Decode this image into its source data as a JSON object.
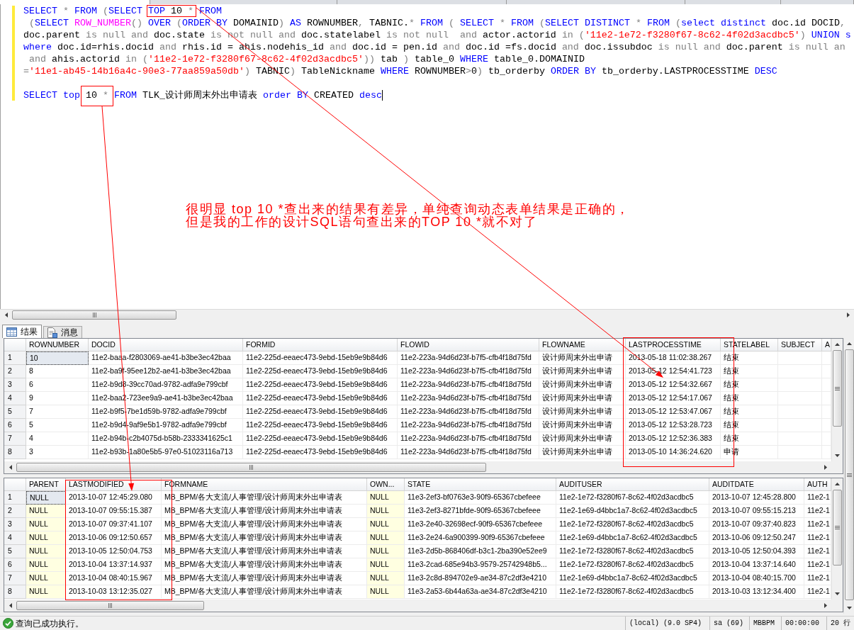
{
  "document_tabs": [
    {
      "selected": true
    },
    {
      "selected": false
    },
    {
      "selected": false
    },
    {
      "selected": false
    },
    {
      "selected": false
    },
    {
      "selected": false
    }
  ],
  "editor": {
    "statements": [
      {
        "lines": [
          {
            "cursor": false,
            "segments": [
              {
                "highlighted": false,
                "tokens": [
                  {
                    "kind": "keyword",
                    "text": "SELECT"
                  },
                  {
                    "kind": "operator",
                    "text": " * "
                  },
                  {
                    "kind": "keyword",
                    "text": "FROM"
                  },
                  {
                    "kind": "operator",
                    "text": " ("
                  },
                  {
                    "kind": "keyword",
                    "text": "SELECT "
                  }
                ]
              },
              {
                "highlighted": true,
                "tokens": [
                  {
                    "kind": "keyword",
                    "text": "TOP"
                  },
                  {
                    "kind": "plain",
                    "text": " 10 "
                  },
                  {
                    "kind": "operator",
                    "text": "*"
                  }
                ]
              },
              {
                "highlighted": false,
                "tokens": [
                  {
                    "kind": "keyword",
                    "text": " FROM"
                  }
                ]
              }
            ]
          },
          {
            "cursor": false,
            "segments": [
              {
                "highlighted": false,
                "tokens": [
                  {
                    "kind": "operator",
                    "text": " ("
                  },
                  {
                    "kind": "keyword",
                    "text": "SELECT "
                  },
                  {
                    "kind": "function",
                    "text": "ROW_NUMBER"
                  },
                  {
                    "kind": "operator",
                    "text": "() "
                  },
                  {
                    "kind": "keyword",
                    "text": "OVER"
                  },
                  {
                    "kind": "operator",
                    "text": " ("
                  },
                  {
                    "kind": "keyword",
                    "text": "ORDER BY"
                  },
                  {
                    "kind": "plain",
                    "text": " DOMAINID"
                  },
                  {
                    "kind": "operator",
                    "text": ") "
                  },
                  {
                    "kind": "keyword",
                    "text": "AS"
                  },
                  {
                    "kind": "plain",
                    "text": " ROWNUMBER"
                  },
                  {
                    "kind": "operator",
                    "text": ","
                  },
                  {
                    "kind": "plain",
                    "text": " TABNIC."
                  },
                  {
                    "kind": "operator",
                    "text": "* "
                  },
                  {
                    "kind": "keyword",
                    "text": "FROM"
                  },
                  {
                    "kind": "operator",
                    "text": " ( "
                  },
                  {
                    "kind": "keyword",
                    "text": "SELECT"
                  },
                  {
                    "kind": "operator",
                    "text": " * "
                  },
                  {
                    "kind": "keyword",
                    "text": "FROM"
                  },
                  {
                    "kind": "operator",
                    "text": " ("
                  },
                  {
                    "kind": "keyword",
                    "text": "SELECT DISTINCT"
                  },
                  {
                    "kind": "operator",
                    "text": " * "
                  },
                  {
                    "kind": "keyword",
                    "text": "FROM"
                  },
                  {
                    "kind": "operator",
                    "text": " ("
                  },
                  {
                    "kind": "keyword",
                    "text": "select distinct"
                  },
                  {
                    "kind": "plain",
                    "text": " doc.id DOCID"
                  },
                  {
                    "kind": "operator",
                    "text": ","
                  }
                ]
              }
            ]
          },
          {
            "cursor": false,
            "segments": [
              {
                "highlighted": false,
                "tokens": [
                  {
                    "kind": "plain",
                    "text": "doc.parent"
                  },
                  {
                    "kind": "operator",
                    "text": " is null and "
                  },
                  {
                    "kind": "plain",
                    "text": "doc.state"
                  },
                  {
                    "kind": "operator",
                    "text": " is not null and "
                  },
                  {
                    "kind": "plain",
                    "text": "doc.statelabel"
                  },
                  {
                    "kind": "operator",
                    "text": " is not null  and "
                  },
                  {
                    "kind": "plain",
                    "text": "actor.actorid "
                  },
                  {
                    "kind": "operator",
                    "text": "in ("
                  },
                  {
                    "kind": "string",
                    "text": "'11e2-1e72-f3280f67-8c62-4f02d3acdbc5'"
                  },
                  {
                    "kind": "operator",
                    "text": ") "
                  },
                  {
                    "kind": "keyword",
                    "text": "UNION s"
                  }
                ]
              }
            ]
          },
          {
            "cursor": false,
            "segments": [
              {
                "highlighted": false,
                "tokens": [
                  {
                    "kind": "keyword",
                    "text": "where"
                  },
                  {
                    "kind": "plain",
                    "text": " doc.id=rhis.docid "
                  },
                  {
                    "kind": "operator",
                    "text": "and"
                  },
                  {
                    "kind": "plain",
                    "text": " rhis.id = ahis.nodehis_id "
                  },
                  {
                    "kind": "operator",
                    "text": "and"
                  },
                  {
                    "kind": "plain",
                    "text": " doc.id = pen.id "
                  },
                  {
                    "kind": "operator",
                    "text": "and"
                  },
                  {
                    "kind": "plain",
                    "text": " doc.id =fs.docid "
                  },
                  {
                    "kind": "operator",
                    "text": "and"
                  },
                  {
                    "kind": "plain",
                    "text": " doc.issubdoc "
                  },
                  {
                    "kind": "operator",
                    "text": "is null and"
                  },
                  {
                    "kind": "plain",
                    "text": " doc.parent "
                  },
                  {
                    "kind": "operator",
                    "text": "is null an"
                  }
                ]
              }
            ]
          },
          {
            "cursor": false,
            "segments": [
              {
                "highlighted": false,
                "tokens": [
                  {
                    "kind": "operator",
                    "text": " and"
                  },
                  {
                    "kind": "plain",
                    "text": " ahis.actorid "
                  },
                  {
                    "kind": "operator",
                    "text": "in ("
                  },
                  {
                    "kind": "string",
                    "text": "'11e2-1e72-f3280f67-8c62-4f02d3acdbc5'"
                  },
                  {
                    "kind": "operator",
                    "text": "))"
                  },
                  {
                    "kind": "plain",
                    "text": " tab "
                  },
                  {
                    "kind": "operator",
                    "text": ")"
                  },
                  {
                    "kind": "plain",
                    "text": " table_0 "
                  },
                  {
                    "kind": "keyword",
                    "text": "WHERE"
                  },
                  {
                    "kind": "plain",
                    "text": " table_0.DOMAINID"
                  }
                ]
              }
            ]
          },
          {
            "cursor": false,
            "segments": [
              {
                "highlighted": false,
                "tokens": [
                  {
                    "kind": "operator",
                    "text": "="
                  },
                  {
                    "kind": "string",
                    "text": "'11e1-ab45-14b16a4c-90e3-77aa859a50db'"
                  },
                  {
                    "kind": "operator",
                    "text": ")"
                  },
                  {
                    "kind": "plain",
                    "text": " TABNIC"
                  },
                  {
                    "kind": "operator",
                    "text": ")"
                  },
                  {
                    "kind": "plain",
                    "text": " TableNickname "
                  },
                  {
                    "kind": "keyword",
                    "text": "WHERE"
                  },
                  {
                    "kind": "plain",
                    "text": " ROWNUMBER"
                  },
                  {
                    "kind": "operator",
                    "text": ">"
                  },
                  {
                    "kind": "plain",
                    "text": "0"
                  },
                  {
                    "kind": "operator",
                    "text": ")"
                  },
                  {
                    "kind": "plain",
                    "text": " tb_orderby "
                  },
                  {
                    "kind": "keyword",
                    "text": "ORDER BY"
                  },
                  {
                    "kind": "plain",
                    "text": " tb_orderby.LASTPROCESSTIME "
                  },
                  {
                    "kind": "keyword",
                    "text": "DESC"
                  }
                ]
              }
            ]
          }
        ]
      },
      {
        "lines": [
          {
            "cursor": true,
            "segments": [
              {
                "highlighted": false,
                "tokens": [
                  {
                    "kind": "keyword",
                    "text": "SELECT top "
                  }
                ]
              },
              {
                "highlighted": true,
                "tokens": [
                  {
                    "kind": "plain",
                    "text": "10 "
                  },
                  {
                    "kind": "operator",
                    "text": "*"
                  }
                ]
              },
              {
                "highlighted": false,
                "tokens": [
                  {
                    "kind": "keyword",
                    "text": " FROM"
                  },
                  {
                    "kind": "plain",
                    "text": " TLK_设计师周末外出申请表 "
                  },
                  {
                    "kind": "keyword",
                    "text": "order BY"
                  },
                  {
                    "kind": "plain",
                    "text": " CREATED "
                  },
                  {
                    "kind": "keyword",
                    "text": "desc"
                  }
                ]
              }
            ]
          }
        ]
      }
    ]
  },
  "annotation": {
    "lines": [
      "很明显 top 10 *查出来的结果有差异，单纯查询动态表单结果是正确的，",
      "但是我的工作的设计SQL语句查出来的TOP 10 *就不对了"
    ]
  },
  "result_tabs": [
    {
      "kind": "results",
      "label": "结果",
      "selected": true
    },
    {
      "kind": "messages",
      "label": "消息",
      "selected": false
    }
  ],
  "grids": [
    {
      "columns": [
        {
          "label": "ROWNUMBER",
          "kind": "text"
        },
        {
          "label": "DOCID",
          "kind": "text"
        },
        {
          "label": "FORMID",
          "kind": "text"
        },
        {
          "label": "FLOWID",
          "kind": "text"
        },
        {
          "label": "FLOWNAME",
          "kind": "text"
        },
        {
          "label": "LASTPROCESSTIME",
          "kind": "text"
        },
        {
          "label": "STATELABEL",
          "kind": "text"
        },
        {
          "label": "SUBJECT",
          "kind": "text"
        },
        {
          "label": "A",
          "kind": "text"
        }
      ],
      "rows": [
        {
          "number": "1",
          "focused": true,
          "cells": [
            "10",
            "11e2-baaa-f2803069-ae41-b3be3ec42baa",
            "11e2-225d-eeaec473-9ebd-15eb9e9b84d6",
            "11e2-223a-94d6d23f-b7f5-cfb4f18d75fd",
            "设计师周末外出申请",
            "2013-05-18 11:02:38.267",
            "结束"
          ]
        },
        {
          "number": "2",
          "focused": false,
          "cells": [
            "8",
            "11e2-ba9f-95ee12b2-ae41-b3be3ec42baa",
            "11e2-225d-eeaec473-9ebd-15eb9e9b84d6",
            "11e2-223a-94d6d23f-b7f5-cfb4f18d75fd",
            "设计师周末外出申请",
            "2013-05-12 12:54:41.723",
            "结束"
          ]
        },
        {
          "number": "3",
          "focused": false,
          "cells": [
            "6",
            "11e2-b9d8-39cc70ad-9782-adfa9e799cbf",
            "11e2-225d-eeaec473-9ebd-15eb9e9b84d6",
            "11e2-223a-94d6d23f-b7f5-cfb4f18d75fd",
            "设计师周末外出申请",
            "2013-05-12 12:54:32.667",
            "结束"
          ]
        },
        {
          "number": "4",
          "focused": false,
          "cells": [
            "9",
            "11e2-baa2-723ee9a9-ae41-b3be3ec42baa",
            "11e2-225d-eeaec473-9ebd-15eb9e9b84d6",
            "11e2-223a-94d6d23f-b7f5-cfb4f18d75fd",
            "设计师周末外出申请",
            "2013-05-12 12:54:17.067",
            "结束"
          ]
        },
        {
          "number": "5",
          "focused": false,
          "cells": [
            "7",
            "11e2-b9f5-7be1d59b-9782-adfa9e799cbf",
            "11e2-225d-eeaec473-9ebd-15eb9e9b84d6",
            "11e2-223a-94d6d23f-b7f5-cfb4f18d75fd",
            "设计师周末外出申请",
            "2013-05-12 12:53:47.067",
            "结束"
          ]
        },
        {
          "number": "6",
          "focused": false,
          "cells": [
            "5",
            "11e2-b9d4-9af9e5b1-9782-adfa9e799cbf",
            "11e2-225d-eeaec473-9ebd-15eb9e9b84d6",
            "11e2-223a-94d6d23f-b7f5-cfb4f18d75fd",
            "设计师周末外出申请",
            "2013-05-12 12:53:28.723",
            "结束"
          ]
        },
        {
          "number": "7",
          "focused": false,
          "cells": [
            "4",
            "11e2-b94b-c2b4075d-b58b-2333341625c1",
            "11e2-225d-eeaec473-9ebd-15eb9e9b84d6",
            "11e2-223a-94d6d23f-b7f5-cfb4f18d75fd",
            "设计师周末外出申请",
            "2013-05-12 12:52:36.383",
            "结束"
          ]
        },
        {
          "number": "8",
          "focused": false,
          "cells": [
            "3",
            "11e2-b93b-1a80e5b5-97e0-51023116a713",
            "11e2-225d-eeaec473-9ebd-15eb9e9b84d6",
            "11e2-223a-94d6d23f-b7f5-cfb4f18d75fd",
            "设计师周末外出申请",
            "2013-05-10 14:36:24.620",
            "申请"
          ]
        }
      ]
    },
    {
      "columns": [
        {
          "label": "PARENT",
          "kind": "null"
        },
        {
          "label": "LASTMODIFIED",
          "kind": "text"
        },
        {
          "label": "FORMNAME",
          "kind": "text"
        },
        {
          "label": "OWN...",
          "kind": "null"
        },
        {
          "label": "STATE",
          "kind": "text"
        },
        {
          "label": "AUDITUSER",
          "kind": "text"
        },
        {
          "label": "AUDITDATE",
          "kind": "text"
        },
        {
          "label": "AUTH",
          "kind": "text"
        }
      ],
      "rows": [
        {
          "number": "1",
          "focused": true,
          "cells": [
            "NULL",
            "2013-10-07 12:45:29.080",
            "MB_BPM/各大支流/人事管理/设计师周末外出申请表",
            "NULL",
            "11e3-2ef3-bf0763e3-90f9-65367cbefeee",
            "11e2-1e72-f3280f67-8c62-4f02d3acdbc5",
            "2013-10-07 12:45:28.800",
            "11e2-1"
          ]
        },
        {
          "number": "2",
          "focused": false,
          "cells": [
            "NULL",
            "2013-10-07 09:55:15.387",
            "MB_BPM/各大支流/人事管理/设计师周末外出申请表",
            "NULL",
            "11e3-2ef3-8271bfde-90f9-65367cbefeee",
            "11e2-1e69-d4bbc1a7-8c62-4f02d3acdbc5",
            "2013-10-07 09:55:15.213",
            "11e2-1"
          ]
        },
        {
          "number": "3",
          "focused": false,
          "cells": [
            "NULL",
            "2013-10-07 09:37:41.107",
            "MB_BPM/各大支流/人事管理/设计师周末外出申请表",
            "NULL",
            "11e3-2e40-32698ecf-90f9-65367cbefeee",
            "11e2-1e72-f3280f67-8c62-4f02d3acdbc5",
            "2013-10-07 09:37:40.823",
            "11e2-1"
          ]
        },
        {
          "number": "4",
          "focused": false,
          "cells": [
            "NULL",
            "2013-10-06 09:12:50.657",
            "MB_BPM/各大支流/人事管理/设计师周末外出申请表",
            "NULL",
            "11e3-2e24-6a900399-90f9-65367cbefeee",
            "11e2-1e69-d4bbc1a7-8c62-4f02d3acdbc5",
            "2013-10-06 09:12:50.247",
            "11e2-1"
          ]
        },
        {
          "number": "5",
          "focused": false,
          "cells": [
            "NULL",
            "2013-10-05 12:50:04.753",
            "MB_BPM/各大支流/人事管理/设计师周末外出申请表",
            "NULL",
            "11e3-2d5b-868406df-b3c1-2ba390e52ee9",
            "11e2-1e72-f3280f67-8c62-4f02d3acdbc5",
            "2013-10-05 12:50:04.393",
            "11e2-1"
          ]
        },
        {
          "number": "6",
          "focused": false,
          "cells": [
            "NULL",
            "2013-10-04 13:37:14.937",
            "MB_BPM/各大支流/人事管理/设计师周末外出申请表",
            "NULL",
            "11e3-2cad-685e94b3-9579-25742948b5...",
            "11e2-1e72-f3280f67-8c62-4f02d3acdbc5",
            "2013-10-04 13:37:14.640",
            "11e2-1"
          ]
        },
        {
          "number": "7",
          "focused": false,
          "cells": [
            "NULL",
            "2013-10-04 08:40:15.967",
            "MB_BPM/各大支流/人事管理/设计师周末外出申请表",
            "NULL",
            "11e3-2c8d-894702e9-ae34-87c2df3e4210",
            "11e2-1e69-d4bbc1a7-8c62-4f02d3acdbc5",
            "2013-10-04 08:40:15.700",
            "11e2-1"
          ]
        },
        {
          "number": "8",
          "focused": false,
          "cells": [
            "NULL",
            "2013-10-03 13:12:35.027",
            "MB_BPM/各大支流/人事管理/设计师周末外出申请表",
            "NULL",
            "11e3-2a53-6b44a63a-ae34-87c2df3e4210",
            "11e2-1e72-f3280f67-8c62-4f02d3acdbc5",
            "2013-10-03 13:12:34.400",
            "11e2-1"
          ]
        }
      ]
    }
  ],
  "status_bar": {
    "message": "查询已成功执行。",
    "sections": [
      "(local) (9.0 SP4)",
      "sa (69)",
      "MBBPM",
      "00:00:00",
      "20 行"
    ]
  }
}
